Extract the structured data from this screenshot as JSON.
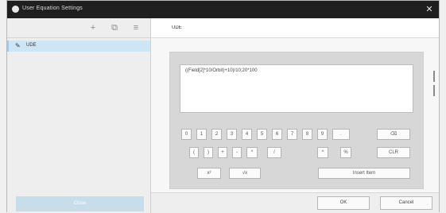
{
  "window": {
    "title": "User Equation Settings",
    "close_glyph": "✕"
  },
  "left_toolbar": {
    "add_glyph": "+",
    "copy_glyph": "⧉",
    "delete_glyph": "≡"
  },
  "equations": [
    {
      "label": "UDE"
    }
  ],
  "left_action_label": "Close",
  "name_field": {
    "value": "UDE"
  },
  "expression": {
    "value": "((Field[2]*10/Orbit)+10)/10;20*100"
  },
  "keypad": {
    "row1": [
      "0",
      "1",
      "2",
      "3",
      "4",
      "5",
      "6",
      "7",
      "8",
      "9",
      "."
    ],
    "backspace": "⌫",
    "row2": [
      "(",
      ")",
      "+",
      "-",
      "*",
      "/"
    ],
    "row2b": [
      "^",
      "%"
    ],
    "clear": "CLR",
    "row3": [
      "x²",
      "√x"
    ],
    "insert_item": "Insert Item"
  },
  "footer": {
    "ok": "OK",
    "cancel": "Cancel"
  }
}
